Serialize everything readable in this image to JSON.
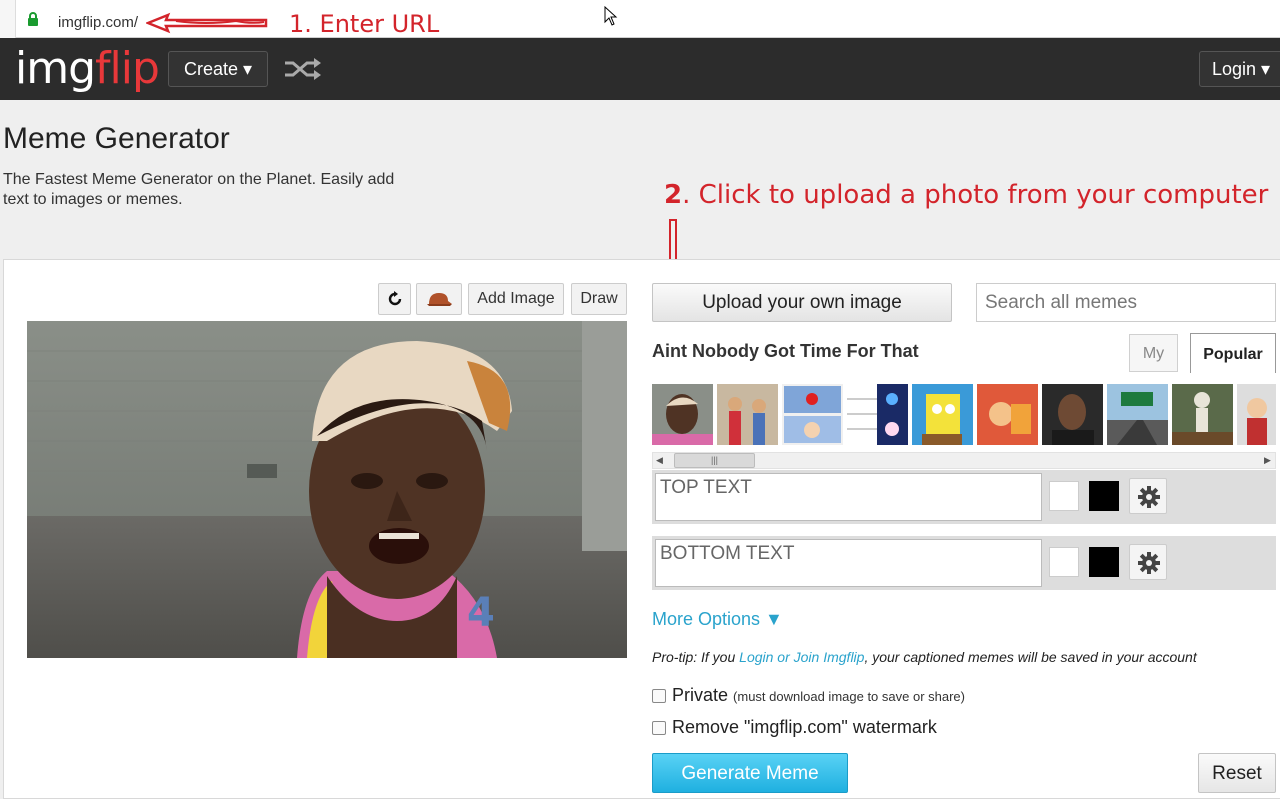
{
  "browser": {
    "url": "imgflip.com/",
    "annotation_step1": "1. Enter URL"
  },
  "navbar": {
    "logo_img": "img",
    "logo_flip": "flip",
    "create_label": "Create ▾",
    "login_label": "Login ▾",
    "shuffle_icon": "shuffle-icon"
  },
  "header": {
    "title": "Meme Generator",
    "subtitle": "The Fastest Meme Generator on the Planet. Easily add text to images or memes.",
    "annotation_step2_num": "2",
    "annotation_step2_text": ". Click to upload a photo from your computer"
  },
  "toolbar": {
    "rotate_icon": "rotate-icon",
    "hat_icon": "hat-icon",
    "add_image_label": "Add Image",
    "draw_label": "Draw"
  },
  "right": {
    "upload_label": "Upload your own image",
    "search_placeholder": "Search all memes",
    "meme_name": "Aint Nobody Got Time For That",
    "tab_my": "My",
    "tab_popular": "Popular"
  },
  "captions": {
    "top_placeholder": "TOP TEXT",
    "bottom_placeholder": "BOTTOM TEXT"
  },
  "options": {
    "more_options": "More Options ▼",
    "protip_prefix": "Pro-tip: If you ",
    "protip_link": "Login or Join Imgflip",
    "protip_suffix": ", your captioned memes will be saved in your account",
    "private_label": "Private",
    "private_note": "(must download image to save or share)",
    "watermark_label": "Remove \"imgflip.com\" watermark",
    "generate_label": "Generate Meme",
    "reset_label": "Reset"
  },
  "colors": {
    "accent": "#2aa3cc",
    "annotation_red": "#d3242b",
    "navbar_bg": "#2c2c2c",
    "logo_red": "#e8383a"
  }
}
